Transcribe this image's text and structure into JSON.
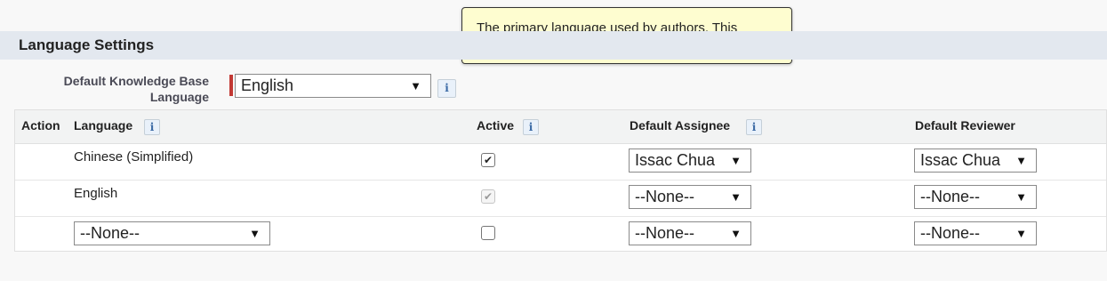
{
  "tooltip": {
    "text": "The primary language used by authors. This setting helps search-engine optimization."
  },
  "section": {
    "title": "Language Settings"
  },
  "default_language": {
    "label": "Default Knowledge Base Language",
    "value": "English",
    "required_color": "#c23934"
  },
  "info_icon": "i",
  "dropdown_caret": "▼",
  "table": {
    "headers": {
      "action": "Action",
      "language": "Language",
      "active": "Active",
      "default_assignee": "Default Assignee",
      "default_reviewer": "Default Reviewer"
    },
    "rows": [
      {
        "language": "Chinese (Simplified)",
        "active": true,
        "active_disabled": false,
        "assignee": "Issac Chua",
        "reviewer": "Issac Chua"
      },
      {
        "language": "English",
        "active": true,
        "active_disabled": true,
        "assignee": "--None--",
        "reviewer": "--None--"
      },
      {
        "language_select": "--None--",
        "active": false,
        "active_disabled": false,
        "assignee": "--None--",
        "reviewer": "--None--"
      }
    ]
  },
  "checkmark_glyph": "✔"
}
